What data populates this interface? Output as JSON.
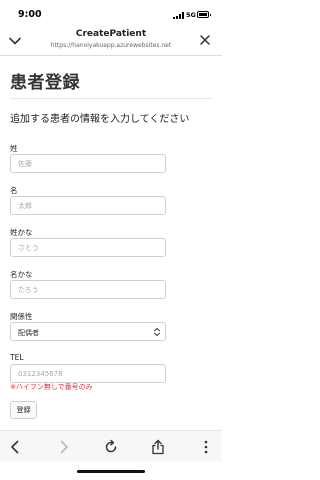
{
  "status_bar": {
    "time": "9:00",
    "network": "5G"
  },
  "browser": {
    "page_name": "CreatePatient",
    "url": "https://hanoiyakuapp.azurewebsites.net"
  },
  "form": {
    "title": "患者登録",
    "subtitle": "追加する患者の情報を入力してください",
    "fields": [
      {
        "label": "姓",
        "placeholder": "佐藤",
        "value": ""
      },
      {
        "label": "名",
        "placeholder": "太郎",
        "value": ""
      },
      {
        "label": "姓かな",
        "placeholder": "さとう",
        "value": ""
      },
      {
        "label": "名かな",
        "placeholder": "たろう",
        "value": ""
      }
    ],
    "relationship": {
      "label": "関係性",
      "selected": "配偶者"
    },
    "tel": {
      "label": "TEL",
      "placeholder": "0312345678",
      "value": "",
      "hint": "※ハイフン無しで番号のみ"
    },
    "submit_label": "登録"
  },
  "icons": {
    "collapse": "chevron-down-icon",
    "close": "close-icon",
    "back": "back-arrow-icon",
    "forward": "forward-arrow-icon",
    "reload": "reload-icon",
    "share": "share-icon",
    "more": "more-vertical-icon"
  }
}
